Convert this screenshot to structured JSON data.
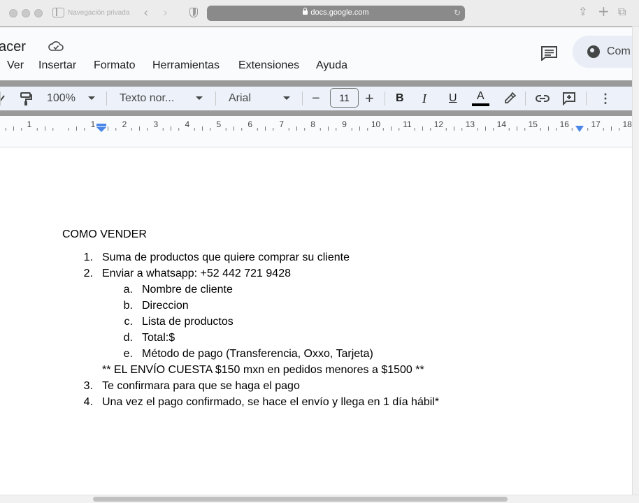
{
  "browser": {
    "private_label": "Navegación privada",
    "url": "docs.google.com"
  },
  "doc": {
    "title": "acer",
    "menu": [
      "Ver",
      "Insertar",
      "Formato",
      "Herramientas",
      "Extensiones",
      "Ayuda"
    ],
    "share_label": "Com"
  },
  "toolbar": {
    "zoom": "100%",
    "style": "Texto nor...",
    "font": "Arial",
    "font_size": "11",
    "bold": "B",
    "italic": "I",
    "underline": "U",
    "text_color": "A",
    "minus": "−",
    "plus": "+",
    "more": "⋮"
  },
  "ruler": {
    "numbers": [
      "1",
      "1",
      "2",
      "3",
      "4",
      "5",
      "6",
      "7",
      "8",
      "9",
      "10",
      "11",
      "12",
      "13",
      "14",
      "15",
      "16",
      "17",
      "18"
    ]
  },
  "content": {
    "heading": "COMO VENDER",
    "items": [
      {
        "marker": "1.",
        "text": "Suma de productos que quiere comprar su cliente"
      },
      {
        "marker": "2.",
        "text": "Enviar a whatsapp: +52 442 721 9428"
      },
      {
        "marker": "a.",
        "text": "Nombre de cliente"
      },
      {
        "marker": "b.",
        "text": "Direccion"
      },
      {
        "marker": "c.",
        "text": "Lista de productos"
      },
      {
        "marker": "d.",
        "text": "Total:$"
      },
      {
        "marker": "e.",
        "text": "Método de pago (Transferencia, Oxxo, Tarjeta)"
      },
      {
        "marker": "",
        "text": "** EL ENVÍO CUESTA $150 mxn en pedidos menores a $1500 **"
      },
      {
        "marker": "3.",
        "text": "Te confirmara para que se haga el pago"
      },
      {
        "marker": "4.",
        "text": "Una vez el pago confirmado, se hace el envío y llega en 1 día hábil*"
      }
    ]
  },
  "colors": {
    "ruler_marker": "#4a86e8",
    "toolbar_bg": "#edf2fa",
    "share_pill_bg": "#e9eef6"
  }
}
